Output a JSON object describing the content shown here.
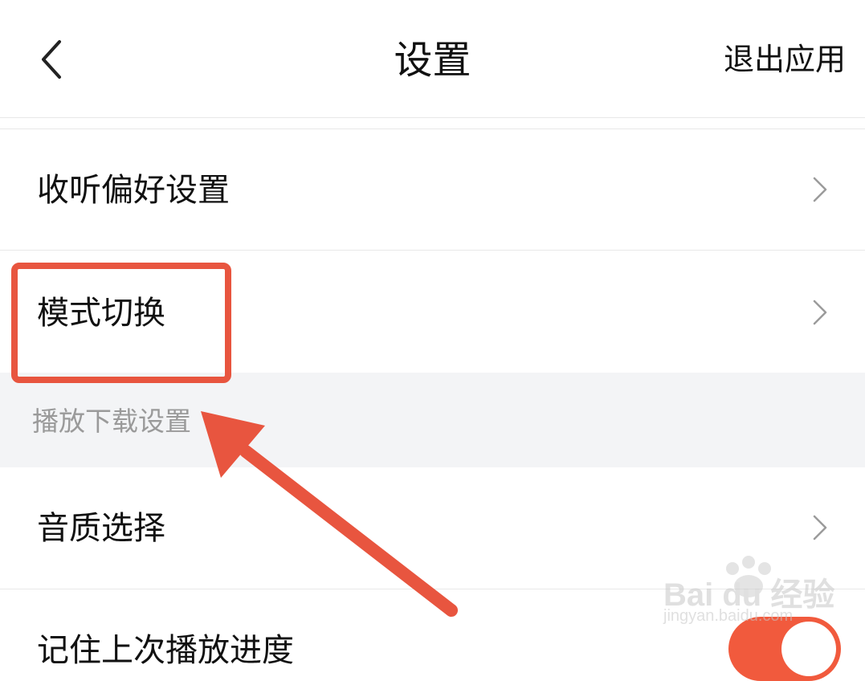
{
  "header": {
    "title": "设置",
    "exit_label": "退出应用"
  },
  "rows": [
    {
      "label": "收听偏好设置"
    },
    {
      "label": "模式切换"
    },
    {
      "label": "音质选择"
    },
    {
      "label": "记住上次播放进度"
    }
  ],
  "section": {
    "label": "播放下载设置"
  },
  "watermark": {
    "brand": "Bai du 经验",
    "url": "jingyan.baidu.com"
  },
  "colors": {
    "accent": "#f15a3d",
    "annotation": "#e8553f"
  }
}
